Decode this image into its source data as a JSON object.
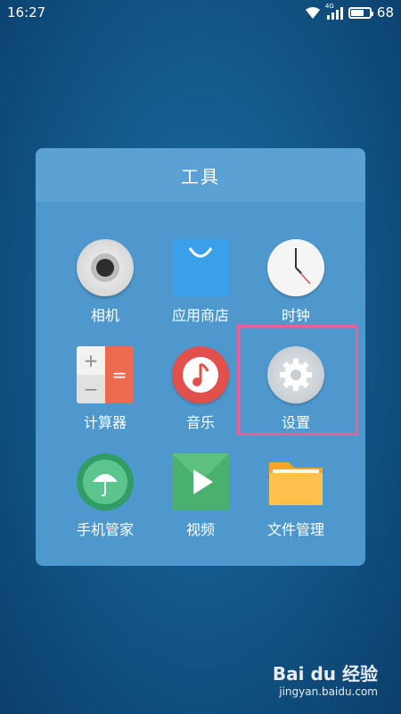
{
  "status_bar": {
    "time": "16:27",
    "network": "4G",
    "battery": "68",
    "battery_level": 0.68
  },
  "folder": {
    "title": "工具",
    "apps": [
      {
        "label": "相机",
        "icon": "camera-icon"
      },
      {
        "label": "应用商店",
        "icon": "app-store-icon"
      },
      {
        "label": "时钟",
        "icon": "clock-icon"
      },
      {
        "label": "计算器",
        "icon": "calculator-icon"
      },
      {
        "label": "音乐",
        "icon": "music-icon"
      },
      {
        "label": "设置",
        "icon": "settings-gear-icon"
      },
      {
        "label": "手机管家",
        "icon": "phone-manager-umbrella-icon"
      },
      {
        "label": "视频",
        "icon": "video-play-icon"
      },
      {
        "label": "文件管理",
        "icon": "folder-icon"
      }
    ]
  },
  "calculator_symbols": {
    "plus": "+",
    "equals": "=",
    "minus": "−"
  },
  "highlight": {
    "target": "设置",
    "color": "#e8609a"
  },
  "watermark": {
    "brand": "Bai du 经验",
    "url": "jingyan.baidu.com"
  }
}
